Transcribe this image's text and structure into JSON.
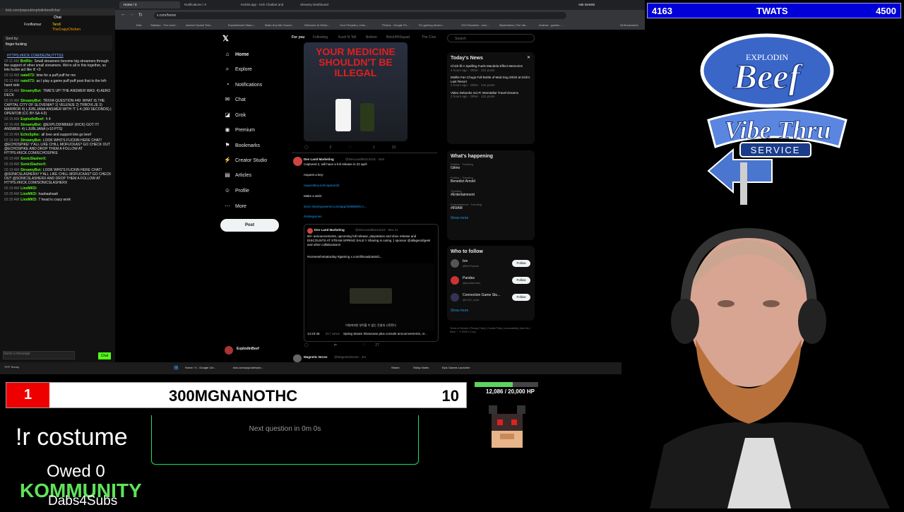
{
  "chat_window": {
    "url": "kick.com/popout/explodinbeef/chat",
    "title": "Chat",
    "pinned_name": "Foolfiamaz",
    "pinned_user1": "Tandi",
    "pinned_user2": "TheCrapyChicken",
    "sent_by": "Sent by:",
    "sent_msg": "finger fucking",
    "input_placeholder": "Send a message",
    "send_label": "Chat",
    "lines": [
      {
        "time": "",
        "user": "",
        "text": "HTTPS://KICK.COM/DEZNUTTTSS"
      },
      {
        "time": "02:11 AM",
        "user": "BotRix:",
        "text": "Small streamers become big streamers through the support of other small streamers. We're all in this together, so lets fuckin act like it! <3"
      },
      {
        "time": "02:12 AM",
        "user": "nate673:",
        "text": "time for a puff puff for me"
      },
      {
        "time": "02:12 AM",
        "user": "nate673:",
        "text": "as I play a game puff puff post that to the left-hand side"
      },
      {
        "time": "02:15 AM",
        "user": "StreamyBot:",
        "text": "TIME'S UP! THE ANSWER WAS: 4) AERO DECK"
      },
      {
        "time": "02:15 AM",
        "user": "StreamyBot:",
        "text": "TRIVIA QUESTION #49: WHAT IS THE CAPITAL CITY OF SLOVENIA? 1) VELENJE 2) TRBOVLJE 3) MARIBOR 4) LJUBLJANA ANSWER WITH !T 1-4 (300 SECONDS) | OPENTDB (CC BY-SA 4.0)"
      },
      {
        "time": "02:15 AM",
        "user": "ExplodinBeef:",
        "text": "!t 4"
      },
      {
        "time": "02:15 AM",
        "user": "StreamyBot:",
        "text": "@EXPLODINBEEF (KICK) GOT IT! ANSWER: 4) LJUBLJANA (+10 PTS)"
      },
      {
        "time": "02:15 AM",
        "user": "EchoSpike:",
        "text": "all love and support lets go beef"
      },
      {
        "time": "02:18 AM",
        "user": "StreamyBot:",
        "text": "LOOK WHO'S FUCKIN HERE CHAT! @ECHOSPIKE! Y'ALL LIKE CHILL MOFUCKAS? GO CHECK OUT @ECHOSPIKE AND DROP THEM A FOLLOW AT HTTPS://KICK.COM/ECHOSPIKE"
      },
      {
        "time": "02:19 AM",
        "user": "SonicSlasherX:",
        "text": ""
      },
      {
        "time": "02:19 AM",
        "user": "SonicSlasherX:",
        "text": ""
      },
      {
        "time": "02:19 AM",
        "user": "StreamyBot:",
        "text": "LOOK WHO'S FUCKIN HERE CHAT! @SONICSLASHERX! Y'ALL LIKE CHILL MOFUCKAS? GO CHECK OUT @SONICSLASHERX AND DROP THEM A FOLLOW AT HTTPS://KICK.COM/SONICSLASHERX"
      },
      {
        "time": "02:19 AM",
        "user": "LinxMKD:",
        "text": ""
      },
      {
        "time": "02:20 AM",
        "user": "LinxMKD:",
        "text": "haahaahaah"
      },
      {
        "time": "02:20 AM",
        "user": "LinxMKD:",
        "text": "7 head is crazy work"
      }
    ]
  },
  "browser": {
    "tabs": [
      "Home / X",
      "Notifications / X",
      "Kicklet.app - Kick Chatbot and",
      "Streamy Dashboard"
    ],
    "url": "x.com/home",
    "bookmarks": [
      "Kick",
      "Stakiryn - The Lead...",
      "Internet Speed Test...",
      "Explodinbeef Stats |...",
      "Make Any Mic Sound...",
      "Welcome to Obfsc...",
      "Your Flexjobs | Jobs...",
      "Photos - Google Ph...",
      "Fix gaming drivers...",
      "XXX Roosters - zero...",
      "Mysteriams | The Ide...",
      "Andrew - games - ...",
      "All Bookmarks"
    ],
    "ask_gemini": "Ask Gemini"
  },
  "x_nav": {
    "items": [
      "Home",
      "Explore",
      "Notifications",
      "Chat",
      "Grok",
      "Premium",
      "Bookmarks",
      "Creator Studio",
      "Articles",
      "Profile",
      "More"
    ],
    "post": "Post",
    "account": "ExplodinBeef"
  },
  "feed": {
    "tabs": [
      "For you",
      "Following",
      "Kush N Tell",
      "Bottom",
      "BotchPitSquad",
      "The Cinn"
    ],
    "image_text": "YOUR MEDICINE SHOULDN'T BE ILLEGAL",
    "tweet1_author": "Dev Land Marketing",
    "tweet1_handle": "@DevLand55213418 · 44m",
    "tweet1_text1": "Captured 2, will have a full release in 22 april",
    "tweet1_text2": "request a key:",
    "tweet1_link1": "requestkey.net/captured2",
    "tweet1_text3": "Make a wish:",
    "tweet1_link2": "store.steampowered.com/app/3398680/CA...",
    "tweet1_tag": "#indiegames",
    "quote_author": "Dev Land Marketing",
    "quote_handle": "@DevLand55213418 · Mar 21",
    "quote_text": "50+ announcements, upcoming full release, playstation and xbox release and DISCOUNTS AT STEAM SPRING SALE !! Sharing is caring :) sponsor @allagesofgeek and other collaborators!",
    "quote_tags": "#screenshotsaturday #gaming x.com/i/broadcasts/1...",
    "video_caption": "이대까지만 부탁할 수 없는 건설의 시작된다",
    "video_time": "14:23:46",
    "video_views": "917 views",
    "video_title": "Spring Steam Showcase plus console announcements, or...",
    "tweet2_author": "Magnetic Norse",
    "tweet2_handle": "@MagneticNorse · 4m",
    "tweet1_replies": "2",
    "tweet1_likes": "1",
    "tweet1_views": "13",
    "tweet2_likes": "27"
  },
  "right_col": {
    "search_placeholder": "Search",
    "news_title": "Today's News",
    "news": [
      {
        "title": "Chick-fil-A Spelling Fuels Mandela Effect Memories",
        "meta": "4 hours ago · Other · 331 posts"
      },
      {
        "title": "Misfits Fan Chugs Full Bottle of Mad Dog 20/20 at Dick's Last Resort",
        "meta": "4 hours ago · Other · 141 posts"
      },
      {
        "title": "Video Debunks Sci-Fi Interstellar Travel Dreams",
        "meta": "2 hours ago · Other · 131 posts"
      }
    ],
    "happening_title": "What's happening",
    "trends": [
      {
        "meta": "Politics · Trending",
        "name": "Gitmo"
      },
      {
        "meta": "Politics · Trending",
        "name": "Benedict Arnold"
      },
      {
        "meta": "Trending",
        "name": "#Entertainment"
      },
      {
        "meta": "Entertainment · Trending",
        "name": "#IRIAM"
      }
    ],
    "show_more": "Show more",
    "who_title": "Who to follow",
    "who": [
      {
        "name": "bre",
        "handle": "@BreTweetz"
      },
      {
        "name": "Pandas",
        "handle": "@pandaredes"
      },
      {
        "name": "Connection Game Stu...",
        "handle": "@CGS_Indie"
      }
    ],
    "follow": "Follow",
    "footer": "Terms of Service | Privacy Policy | Cookie Policy | Accessibility | Ads info | More ··· © 2025 X Corp."
  },
  "taskbar": {
    "weather": "79°F Sunny",
    "items": [
      "Home / X - Google Chr...",
      "kick.com/popout/explo...",
      "",
      "",
      "Steam",
      "Sticky Notes",
      "Epic Games Launcher"
    ],
    "time": "2:20 AM",
    "date": "3/22/2025"
  },
  "overlay": {
    "top_left_score": "4163",
    "top_title": "TWATS",
    "top_right_score": "4500",
    "rank": "1",
    "player_name": "300MGNANOTHC",
    "player_score": "10",
    "hp_text": "12,086 / 20,000 HP",
    "hp_fraction": 0.6043,
    "next_question": "Next question in 0m 0s",
    "command": "!r costume",
    "owed": "Owed 0",
    "community": "KOMMUNITY",
    "dabs": "Dabs4Subs",
    "logo_line1": "EXPLODIN",
    "logo_line2": "Beef",
    "logo_line3": "Vibe Thru",
    "logo_line4": "SERVICE"
  },
  "colors": {
    "kick_green": "#53fc18",
    "x_blue": "#1d9bf0",
    "overlay_blue": "#0000d8",
    "overlay_red": "#e00000"
  }
}
